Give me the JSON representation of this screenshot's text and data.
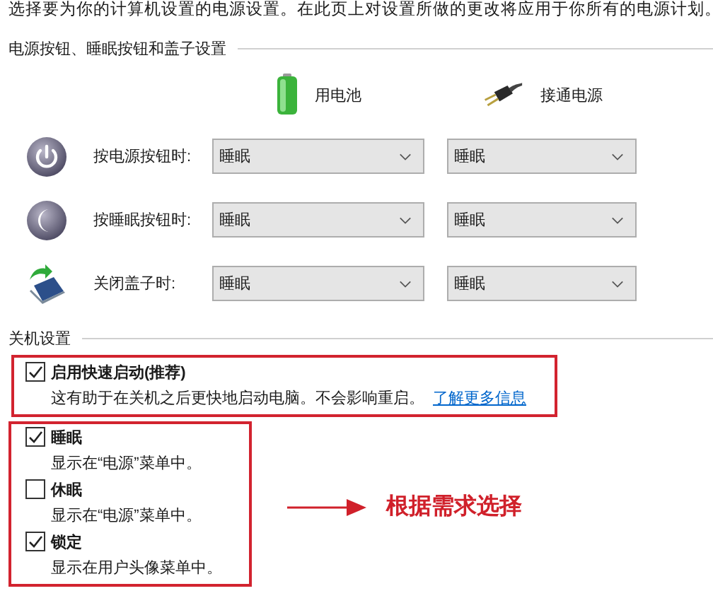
{
  "intro": "选择要为你的计算机设置的电源设置。在此页上对设置所做的更改将应用于你所有的电源计划。",
  "button_section": {
    "title": "电源按钮、睡眠按钮和盖子设置",
    "columns": [
      {
        "kind": "battery",
        "label": "用电池"
      },
      {
        "kind": "plug",
        "label": "接通电源"
      }
    ],
    "rows": [
      {
        "kind": "power",
        "label": "按电源按钮时:",
        "values": [
          "睡眠",
          "睡眠"
        ]
      },
      {
        "kind": "sleep",
        "label": "按睡眠按钮时:",
        "values": [
          "睡眠",
          "睡眠"
        ]
      },
      {
        "kind": "lid",
        "label": "关闭盖子时:",
        "values": [
          "睡眠",
          "睡眠"
        ]
      }
    ]
  },
  "shutdown_section": {
    "title": "关机设置",
    "groups": [
      {
        "options": [
          {
            "label": "启用快速启动(推荐)",
            "checked": true,
            "description": "这有助于在关机之后更快地启动电脑。不会影响重启。",
            "link": "了解更多信息"
          }
        ]
      },
      {
        "options": [
          {
            "label": "睡眠",
            "checked": true,
            "description": "显示在“电源”菜单中。"
          },
          {
            "label": "休眠",
            "checked": false,
            "description": "显示在“电源”菜单中。"
          },
          {
            "label": "锁定",
            "checked": true,
            "description": "显示在用户头像菜单中。"
          }
        ]
      }
    ]
  },
  "annotation": {
    "text": "根据需求选择"
  }
}
